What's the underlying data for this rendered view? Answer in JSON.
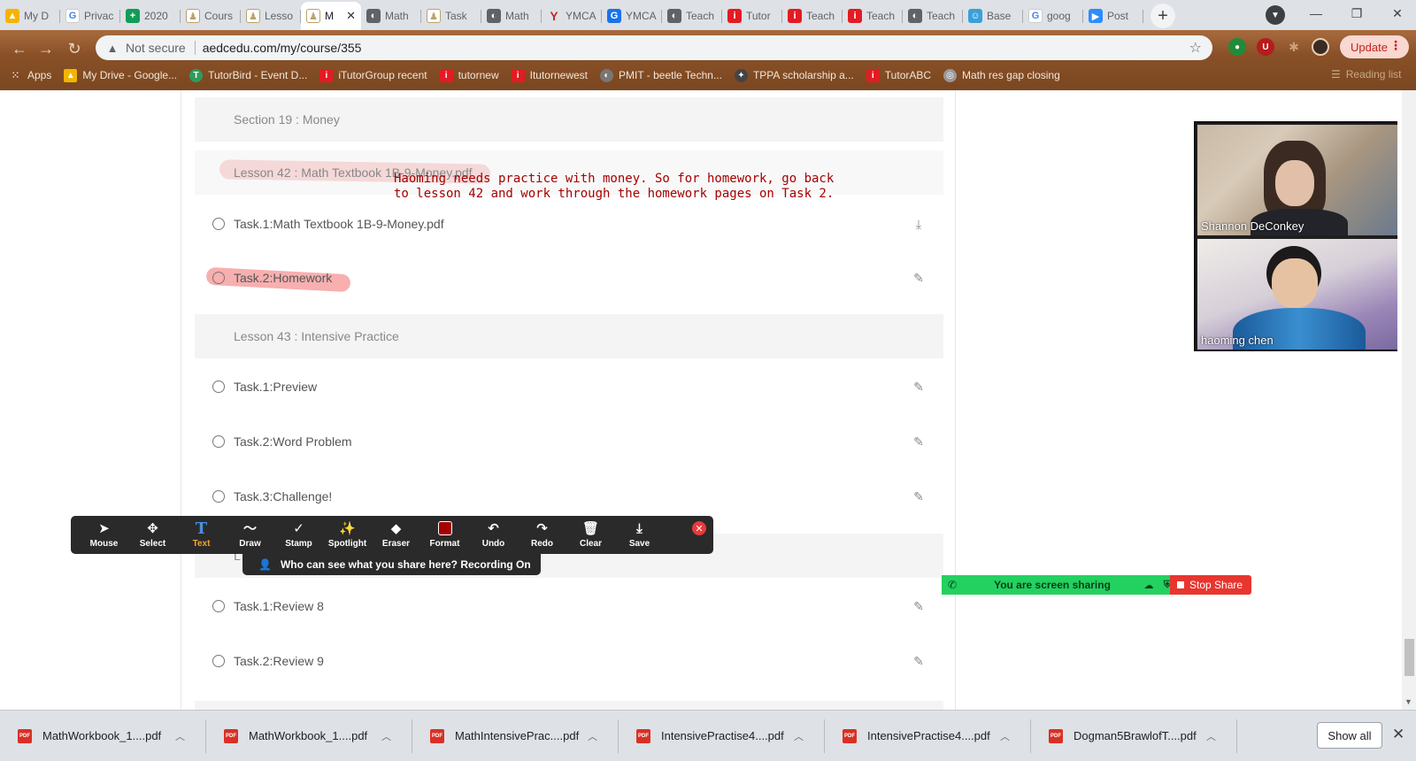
{
  "browser": {
    "tabs": [
      {
        "label": "My D",
        "icon": "google-drive-icon",
        "color": "#f4b400"
      },
      {
        "label": "Privac",
        "icon": "google-icon",
        "color": "#4285f4"
      },
      {
        "label": "2020",
        "icon": "sheets-icon",
        "color": "#0f9d58"
      },
      {
        "label": "Cours",
        "icon": "course-icon",
        "color": "#b8a36a"
      },
      {
        "label": "Lesso",
        "icon": "course-icon",
        "color": "#b8a36a"
      },
      {
        "label": "M",
        "icon": "course-icon",
        "color": "#b8a36a",
        "active": true
      },
      {
        "label": "Math",
        "icon": "globe-icon",
        "color": "#5f6368"
      },
      {
        "label": "Task",
        "icon": "course-icon",
        "color": "#b8a36a"
      },
      {
        "label": "Math",
        "icon": "globe-icon",
        "color": "#5f6368"
      },
      {
        "label": "YMCA",
        "icon": "ymca-icon",
        "color": "#c62828"
      },
      {
        "label": "YMCA",
        "icon": "translate-icon",
        "color": "#1a73e8"
      },
      {
        "label": "Teach",
        "icon": "globe-icon",
        "color": "#5f6368"
      },
      {
        "label": "Tutor",
        "icon": "tutorabc-icon",
        "color": "#e31b23"
      },
      {
        "label": "Teach",
        "icon": "tutorabc-icon",
        "color": "#e31b23"
      },
      {
        "label": "Teach",
        "icon": "tutorabc-icon",
        "color": "#e31b23"
      },
      {
        "label": "Teach",
        "icon": "globe-icon",
        "color": "#5f6368"
      },
      {
        "label": "Base",
        "icon": "base-icon",
        "color": "#3aa0d8"
      },
      {
        "label": "goog",
        "icon": "google-icon",
        "color": "#4285f4"
      },
      {
        "label": "Post",
        "icon": "zoom-icon",
        "color": "#2d8cff"
      }
    ],
    "url": "aedcedu.com/my/course/355",
    "not_secure": "Not secure",
    "update_label": "Update",
    "bookmarks": [
      {
        "label": "Apps",
        "icon": "apps-grid-icon",
        "color": "#5f6368"
      },
      {
        "label": "My Drive - Google...",
        "icon": "google-drive-icon",
        "color": "#f4b400"
      },
      {
        "label": "TutorBird - Event D...",
        "icon": "tutorbird-icon",
        "color": "#2e9c5b"
      },
      {
        "label": "iTutorGroup recent",
        "icon": "tutorabc-icon",
        "color": "#e31b23"
      },
      {
        "label": "tutornew",
        "icon": "tutorabc-icon",
        "color": "#e31b23"
      },
      {
        "label": "Itutornewest",
        "icon": "tutorabc-icon",
        "color": "#e31b23"
      },
      {
        "label": "PMIT - beetle Techn...",
        "icon": "globe-icon",
        "color": "#777777"
      },
      {
        "label": "TPPA scholarship a...",
        "icon": "tppa-icon",
        "color": "#444444"
      },
      {
        "label": "TutorABC",
        "icon": "tutorabc-icon",
        "color": "#e31b23"
      },
      {
        "label": "Math res gap closing",
        "icon": "globe-icon",
        "color": "#999999"
      }
    ],
    "reading_list": "Reading list"
  },
  "course": {
    "section_19": "Section 19 : Money",
    "lesson_42": "Lesson 42 : Math Textbook 1B-9-Money.pdf",
    "lesson_42_tasks": [
      "Task.1:Math Textbook 1B-9-Money.pdf",
      "Task.2:Homework"
    ],
    "lesson_43": "Lesson 43 : Intensive Practice",
    "lesson_43_tasks": [
      "Task.1:Preview",
      "Task.2:Word Problem",
      "Task.3:Challenge!"
    ],
    "lesson_44_partial": "L",
    "lesson_44_tasks": [
      "Task.1:Review 8",
      "Task.2:Review 9"
    ],
    "annotation": "Haoming needs practice with money.  So for homework, go back to lesson 42 and work through the homework pages on Task 2."
  },
  "video": {
    "participants": [
      {
        "name": "Shannon DeConkey"
      },
      {
        "name": "haoming   chen"
      }
    ]
  },
  "zoom_toolbar": {
    "tools": [
      "Mouse",
      "Select",
      "Text",
      "Draw",
      "Stamp",
      "Spotlight",
      "Eraser",
      "Format",
      "Undo",
      "Redo",
      "Clear",
      "Save"
    ],
    "active_tool": "Text",
    "who_can_see": "Who can see what you share here? Recording On",
    "sharing_text": "You are screen sharing",
    "stop_share": "Stop Share"
  },
  "downloads": {
    "items": [
      "MathWorkbook_1....pdf",
      "MathWorkbook_1....pdf",
      "MathIntensivePrac....pdf",
      "IntensivePractise4....pdf",
      "IntensivePractise4....pdf",
      "Dogman5BrawlofT....pdf"
    ],
    "show_all": "Show all"
  }
}
